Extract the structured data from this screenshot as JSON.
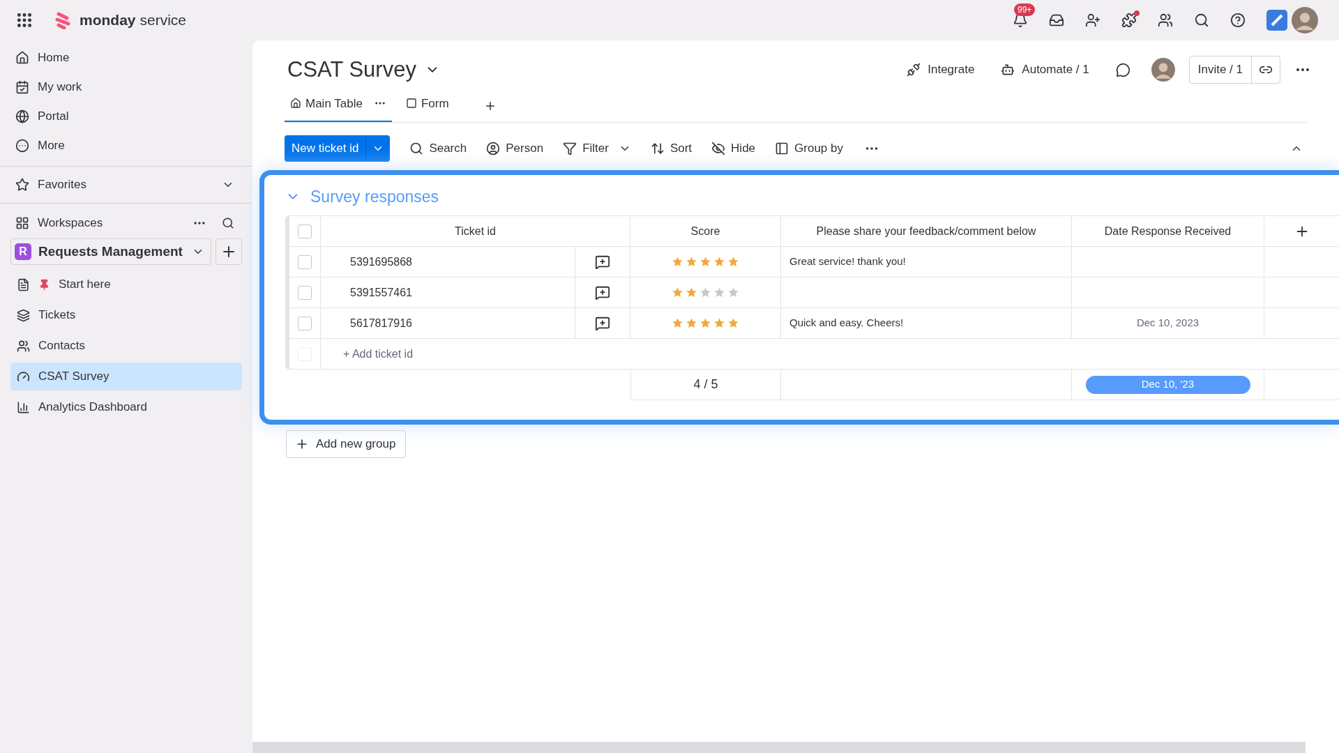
{
  "top_bar": {
    "brand_bold": "monday",
    "brand_light": "service",
    "notification_badge": "99+"
  },
  "sidebar": {
    "nav": [
      {
        "label": "Home"
      },
      {
        "label": "My work"
      },
      {
        "label": "Portal"
      },
      {
        "label": "More"
      }
    ],
    "favorites": "Favorites",
    "workspaces": "Workspaces",
    "workspace": {
      "initial": "R",
      "name": "Requests Management"
    },
    "boards": [
      {
        "label": "Start here",
        "selected": false
      },
      {
        "label": "Tickets",
        "selected": false
      },
      {
        "label": "Contacts",
        "selected": false
      },
      {
        "label": "CSAT Survey",
        "selected": true
      },
      {
        "label": "Analytics Dashboard",
        "selected": false
      }
    ]
  },
  "board": {
    "title": "CSAT Survey",
    "integrate": "Integrate",
    "automate": "Automate / 1",
    "invite": "Invite / 1",
    "tabs": [
      {
        "label": "Main Table",
        "selected": true
      },
      {
        "label": "Form",
        "selected": false
      }
    ],
    "new_button": "New ticket id",
    "tools": [
      "Search",
      "Person",
      "Filter",
      "Sort",
      "Hide",
      "Group by"
    ],
    "group": {
      "title": "Survey responses",
      "columns": [
        "Ticket id",
        "Score",
        "Please share your feedback/comment below",
        "Date Response Received"
      ],
      "header_checked": false,
      "rows": [
        {
          "ticket_id": "5391695868",
          "checked": false,
          "stars": 5,
          "feedback": "Great service! thank you!"
        },
        {
          "ticket_id": "5391557461",
          "checked": false,
          "stars": 2
        },
        {
          "ticket_id": "5617817916",
          "checked": false,
          "stars": 5,
          "feedback": "Quick and easy. Cheers!",
          "date": "Dec 10, 2023"
        }
      ],
      "add_row_checkbox_disabled": true,
      "add_row": "+ Add ticket id",
      "summary_score": "4 / 5",
      "summary_date": "Dec 10, '23"
    },
    "add_group": "Add new group"
  }
}
